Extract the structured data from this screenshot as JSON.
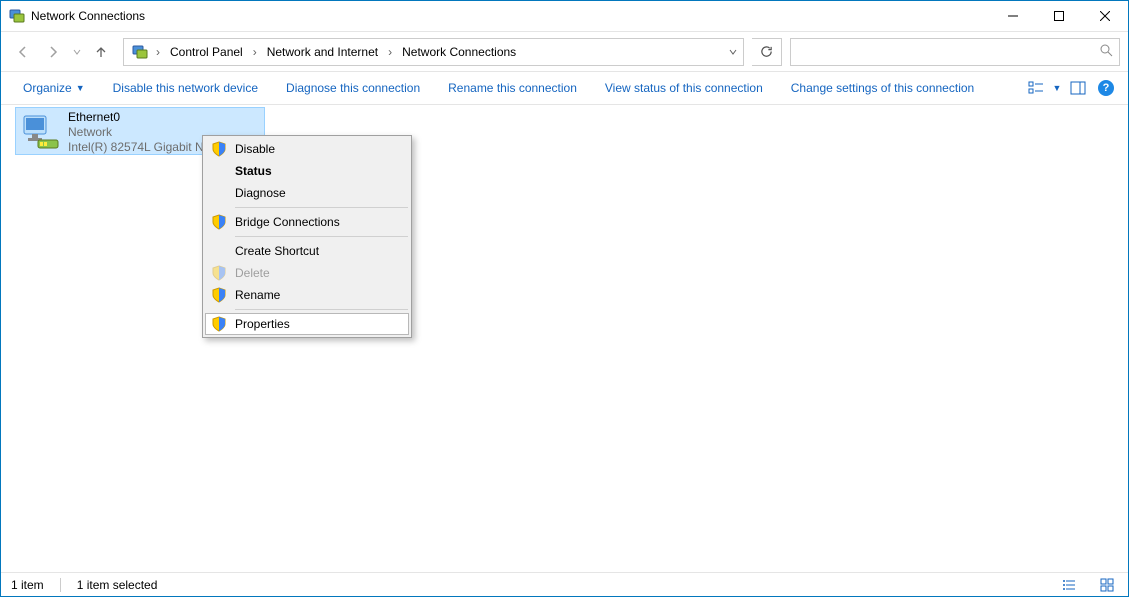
{
  "window": {
    "title": "Network Connections"
  },
  "breadcrumb": {
    "segments": [
      "Control Panel",
      "Network and Internet",
      "Network Connections"
    ]
  },
  "search": {
    "placeholder": ""
  },
  "commandbar": {
    "organize": "Organize",
    "disable_device": "Disable this network device",
    "diagnose": "Diagnose this connection",
    "rename": "Rename this connection",
    "view_status": "View status of this connection",
    "change_settings": "Change settings of this connection"
  },
  "adapter": {
    "name": "Ethernet0",
    "status": "Network",
    "device": "Intel(R) 82574L Gigabit N"
  },
  "context_menu": {
    "disable": "Disable",
    "status": "Status",
    "diagnose": "Diagnose",
    "bridge": "Bridge Connections",
    "create_shortcut": "Create Shortcut",
    "delete": "Delete",
    "rename": "Rename",
    "properties": "Properties"
  },
  "statusbar": {
    "count": "1 item",
    "selected": "1 item selected"
  }
}
